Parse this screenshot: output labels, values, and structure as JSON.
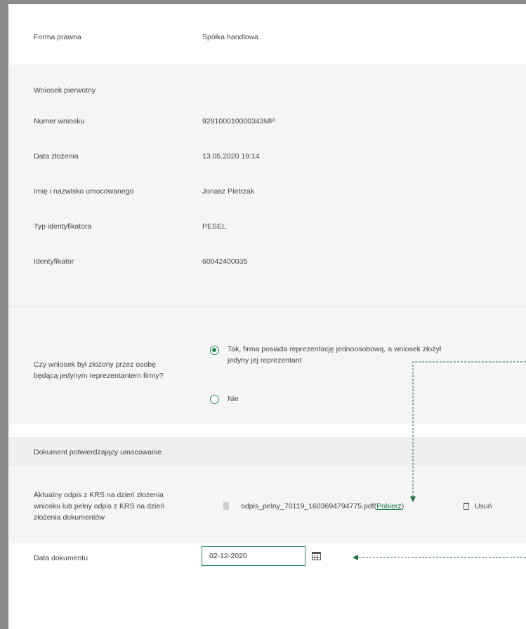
{
  "company": {
    "legal_form_label": "Forma prawna",
    "legal_form_value": "Spółka handlowa"
  },
  "original_application": {
    "section_title": "Wniosek pierwotny",
    "fields": [
      {
        "label": "Numer wniosku",
        "value": "929100010000343MP"
      },
      {
        "label": "Data złożenia",
        "value": "13.05.2020 19:14"
      },
      {
        "label": "Imię i nazwisko umocowanego",
        "value": "Jonasz Pietrzak"
      },
      {
        "label": "Typ identyfikatora",
        "value": "PESEL"
      },
      {
        "label": "Identyfikator",
        "value": "60042400035"
      }
    ]
  },
  "question": {
    "label_line1": "Czy wniosek był złożony przez osobę",
    "label_line2": "będącą jedynym reprezentantem firmy?",
    "option_yes_line1": "Tak, firma posiada reprezentację jednoosobową, a wniosek złożył",
    "option_yes_line2": "jedyny jej reprezentant",
    "option_no": "Nie",
    "selected": "yes"
  },
  "document": {
    "section_title": "Dokument potwierdzający umocowanie",
    "krs_label_line1": "Aktualny odpis z KRS na dzień złożenia",
    "krs_label_line2": "wniosku lub pełny odpis z KRS na dzień",
    "krs_label_line3": "złożenia dokumentów",
    "file_name": "odpis_pelny_70119_1603694794775.pdf",
    "download_open": "(",
    "download_label": "Pobierz",
    "download_close": ")",
    "delete_label": "Usuń",
    "date_label": "Data dokumentu",
    "date_value": "02-12-2020"
  },
  "colors": {
    "accent": "#1e8c52",
    "link": "#0f7a3e",
    "band": "#f5f5f5",
    "arrow": "#1e6e3e"
  }
}
